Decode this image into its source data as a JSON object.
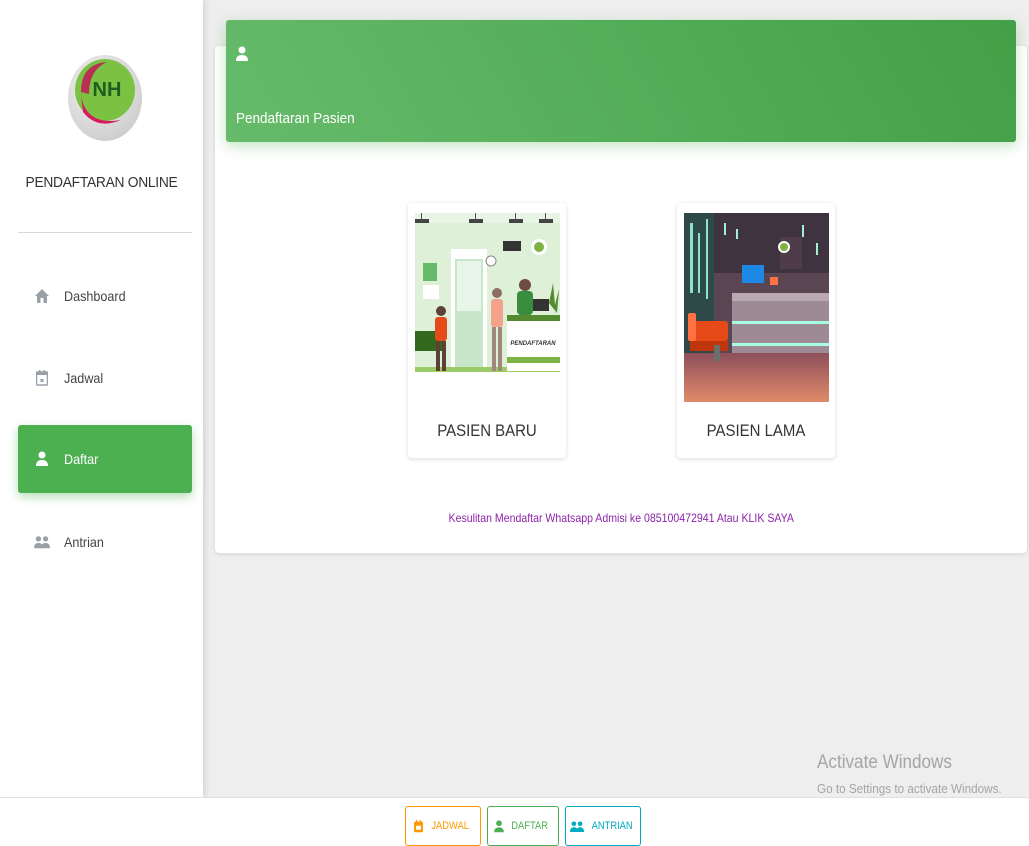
{
  "sidebar": {
    "logo_text": "NH",
    "brand": "PENDAFTARAN ONLINE",
    "items": [
      {
        "label": "Dashboard",
        "icon": "home-icon",
        "active": false
      },
      {
        "label": "Jadwal",
        "icon": "calendar-icon",
        "active": false
      },
      {
        "label": "Daftar",
        "icon": "person-icon",
        "active": true
      },
      {
        "label": "Antrian",
        "icon": "people-icon",
        "active": false
      }
    ]
  },
  "header": {
    "icon": "person-icon",
    "title": "Pendaftaran Pasien"
  },
  "options": [
    {
      "label": "PASIEN BARU",
      "image": "registration-desk-illustration",
      "desk_text": "PENDAFTARAN"
    },
    {
      "label": "PASIEN LAMA",
      "image": "lobby-illustration"
    }
  ],
  "help_text": "Kesulitan Mendaftar Whatsapp Admisi ke 085100472941 Atau KLIK SAYA",
  "bottom_nav": [
    {
      "label": "JADWAL",
      "icon": "calendar-icon",
      "color": "#ff9800"
    },
    {
      "label": "DAFTAR",
      "icon": "person-icon",
      "color": "#4caf50"
    },
    {
      "label": "ANTRIAN",
      "icon": "people-icon",
      "color": "#00acc1"
    }
  ],
  "watermark": {
    "line1": "Activate Windows",
    "line2": "Go to Settings to activate Windows."
  },
  "colors": {
    "accent": "#4caf50",
    "link": "#8e24aa",
    "background": "#eeeeee"
  }
}
